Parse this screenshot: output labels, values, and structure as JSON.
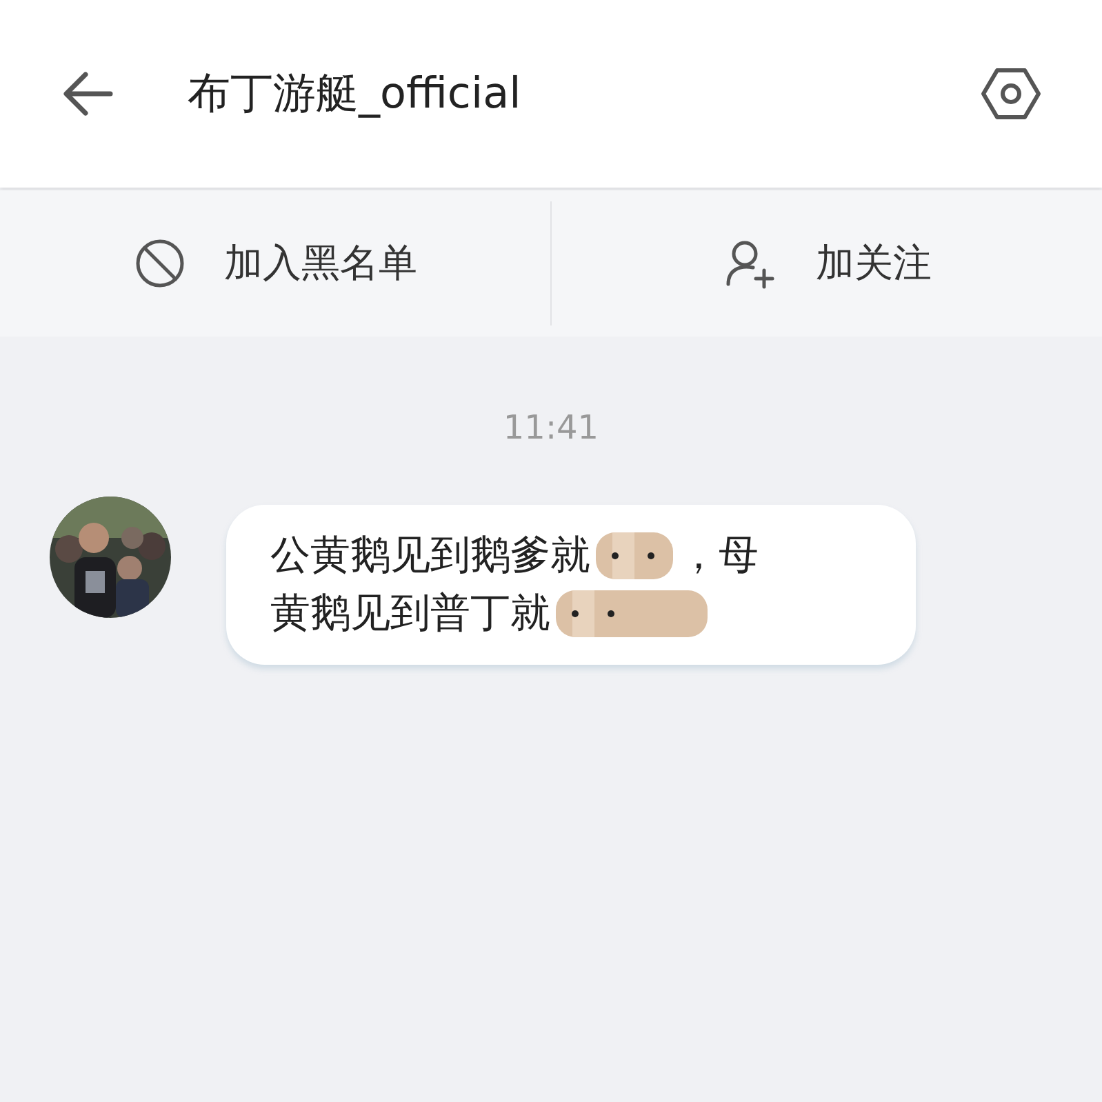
{
  "header": {
    "title": "布丁游艇_official"
  },
  "actions": [
    {
      "kind": "block",
      "label": "加入黑名单"
    },
    {
      "kind": "follow",
      "label": "加关注"
    }
  ],
  "timestamp": "11:41",
  "message": {
    "lines": [
      [
        {
          "kind": "text",
          "text": "公黄鹅见到鹅爹就"
        },
        {
          "kind": "censored"
        },
        {
          "kind": "text",
          "text": "，母"
        }
      ],
      [
        {
          "kind": "text",
          "text": "黄鹅见到普丁就"
        },
        {
          "kind": "censored"
        }
      ]
    ]
  }
}
